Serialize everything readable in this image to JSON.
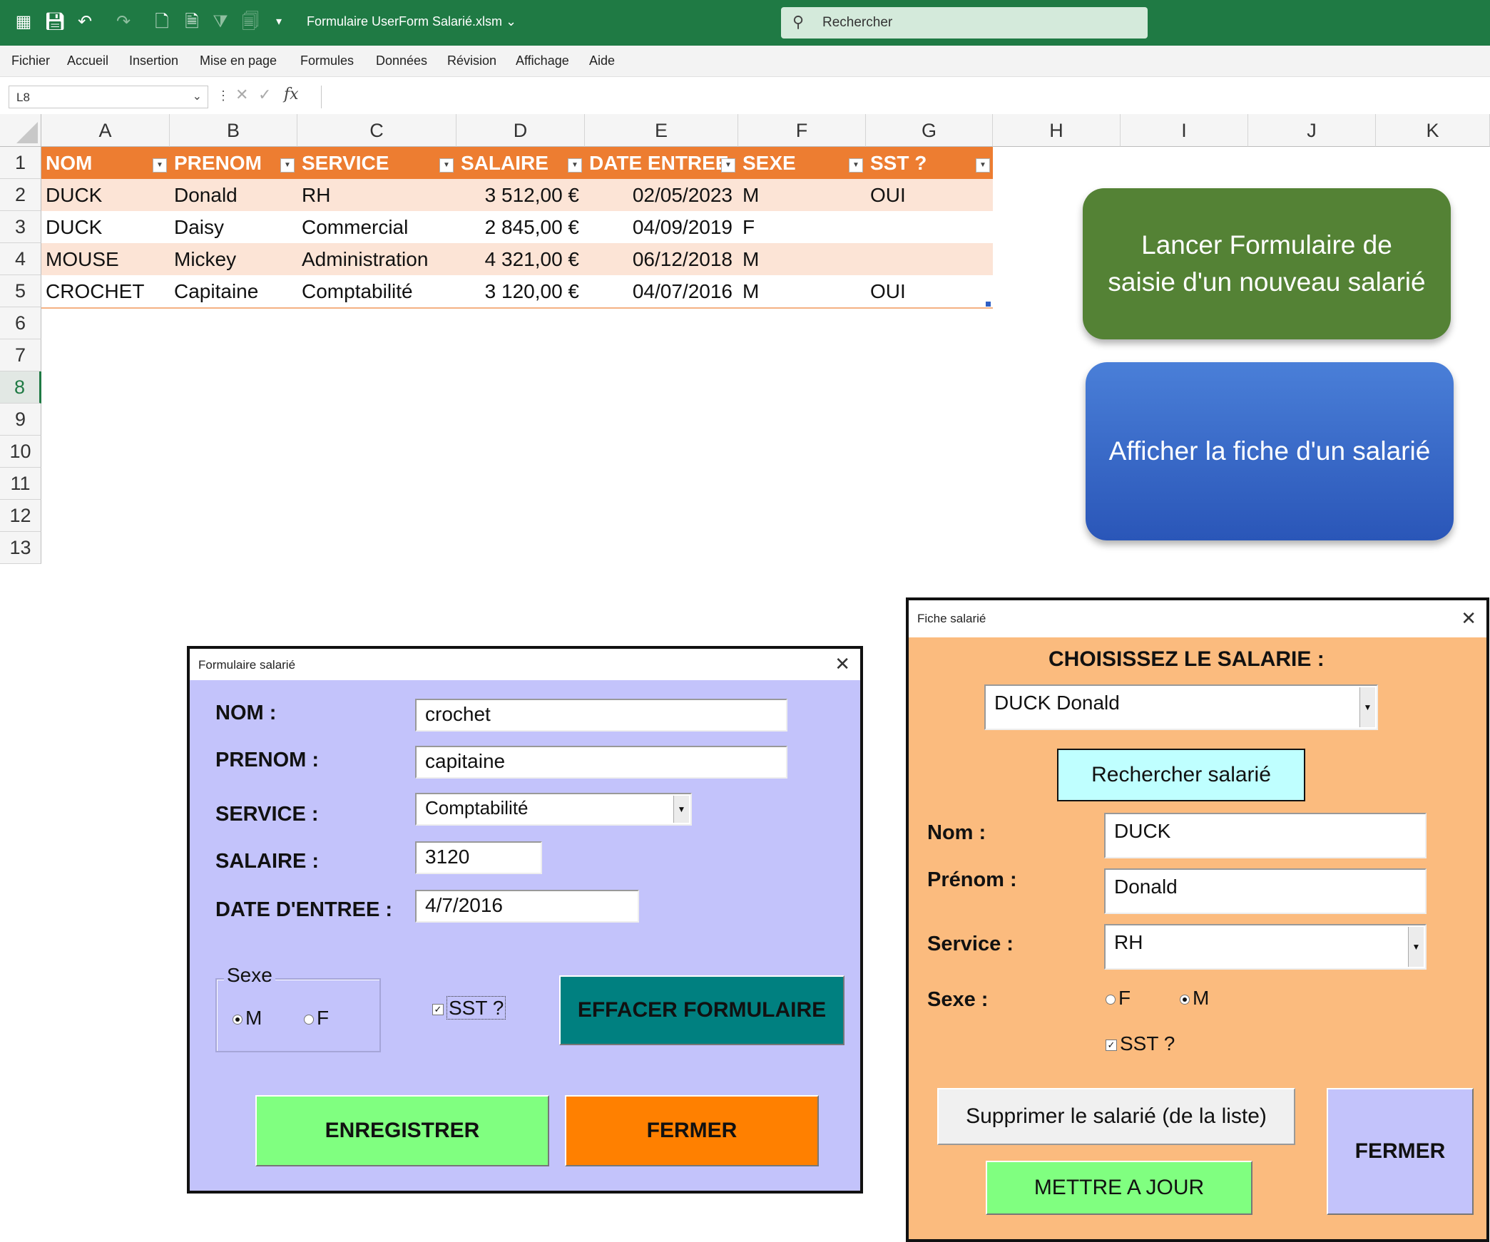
{
  "app": {
    "filename": "Formulaire UserForm Salarié.xlsm",
    "search_placeholder": "Rechercher"
  },
  "menu": [
    "Fichier",
    "Accueil",
    "Insertion",
    "Mise en page",
    "Formules",
    "Données",
    "Révision",
    "Affichage",
    "Aide"
  ],
  "formula_bar": {
    "cell_ref": "L8",
    "fx": "fx",
    "value": ""
  },
  "columns": [
    "A",
    "B",
    "C",
    "D",
    "E",
    "F",
    "G",
    "H",
    "I",
    "J",
    "K"
  ],
  "rows": [
    "1",
    "2",
    "3",
    "4",
    "5",
    "6",
    "7",
    "8",
    "9",
    "10",
    "11",
    "12",
    "13"
  ],
  "active_row": "8",
  "table": {
    "headers": [
      "NOM",
      "PRENOM",
      "SERVICE",
      "SALAIRE",
      "DATE ENTREE",
      "SEXE",
      "SST ?"
    ],
    "rows": [
      [
        "DUCK",
        "Donald",
        "RH",
        "3 512,00 €",
        "02/05/2023",
        "M",
        "OUI"
      ],
      [
        "DUCK",
        "Daisy",
        "Commercial",
        "2 845,00 €",
        "04/09/2019",
        "F",
        ""
      ],
      [
        "MOUSE",
        "Mickey",
        "Administration",
        "4 321,00 €",
        "06/12/2018",
        "M",
        ""
      ],
      [
        "CROCHET",
        "Capitaine",
        "Comptabilité",
        "3 120,00 €",
        "04/07/2016",
        "M",
        "OUI"
      ]
    ],
    "header_color": "#ed7d31",
    "band_color": "#fce4d6"
  },
  "macro_buttons": {
    "new": "Lancer Formulaire de saisie d'un nouveau salarié",
    "view": "Afficher la fiche d'un salarié"
  },
  "form1": {
    "title": "Formulaire salarié",
    "nom_label": "NOM :",
    "nom_value": "crochet",
    "prenom_label": "PRENOM :",
    "prenom_value": "capitaine",
    "service_label": "SERVICE :",
    "service_value": "Comptabilité",
    "salaire_label": "SALAIRE :",
    "salaire_value": "3120",
    "date_label": "DATE D'ENTREE :",
    "date_value": "4/7/2016",
    "sexe_frame": "Sexe",
    "radio_m": "M",
    "radio_f": "F",
    "sst_label": "SST ?",
    "clear_button": "EFFACER FORMULAIRE",
    "save_button": "ENREGISTRER",
    "close_button": "FERMER"
  },
  "form2": {
    "title": "Fiche salarié",
    "heading": "CHOISISSEZ LE SALARIE :",
    "select_value": "DUCK Donald",
    "search_button": "Rechercher salarié",
    "nom_label": "Nom :",
    "nom_value": "DUCK",
    "prenom_label": "Prénom :",
    "prenom_value": "Donald",
    "service_label": "Service :",
    "service_value": "RH",
    "sexe_label": "Sexe :",
    "radio_f": "F",
    "radio_m": "M",
    "sst_label": "SST ?",
    "delete_button": "Supprimer le salarié (de la liste)",
    "update_button": "METTRE A JOUR",
    "close_button": "FERMER"
  }
}
